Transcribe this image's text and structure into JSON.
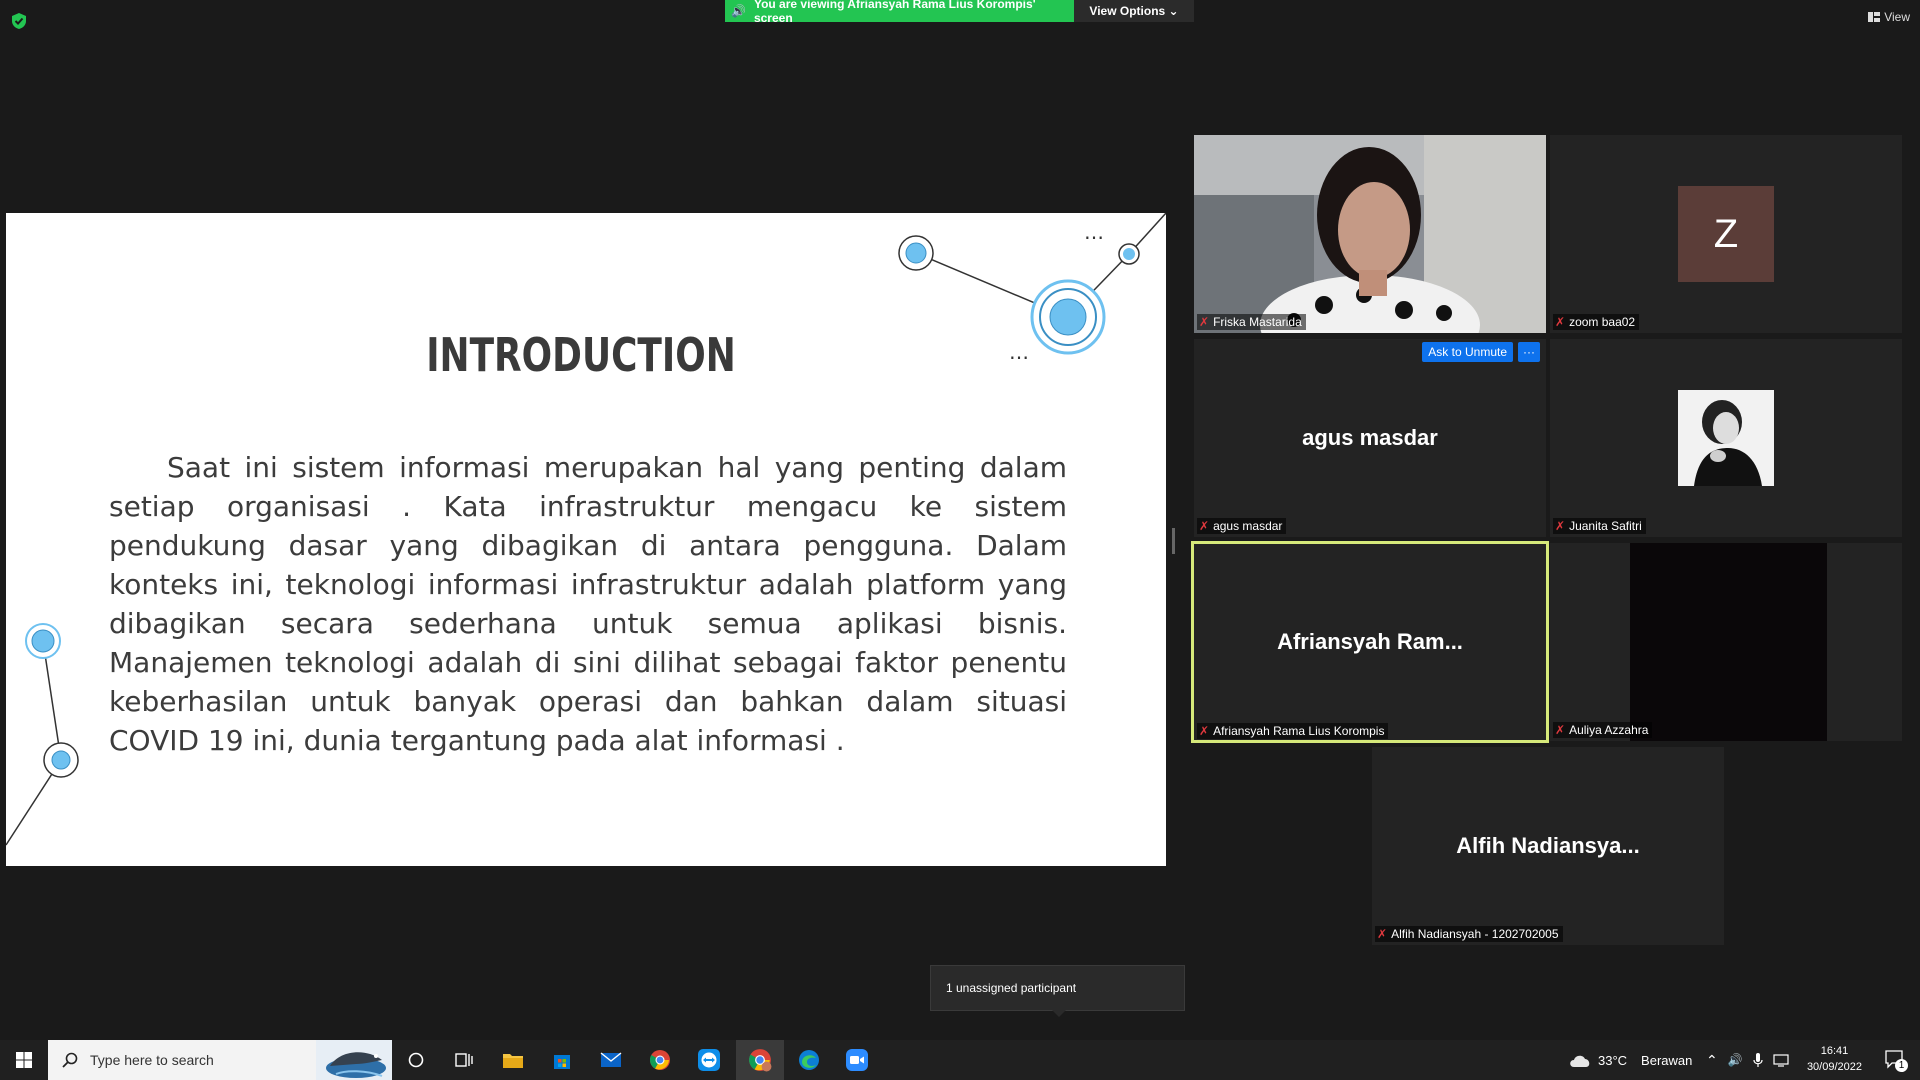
{
  "banner": {
    "viewing_text": "You are viewing Afriansyah Rama Lius Korompis' screen",
    "view_options_label": "View Options ⌄",
    "view_label": "View"
  },
  "slide": {
    "title": "INTRODUCTION",
    "body": "Saat ini sistem informasi merupakan hal yang penting dalam setiap organisasi . Kata infrastruktur mengacu ke sistem pendukung dasar yang dibagikan di antara pengguna. Dalam konteks ini, teknologi informasi infrastruktur adalah platform yang dibagikan secara sederhana untuk semua aplikasi bisnis. Manajemen teknologi adalah di sini dilihat sebagai faktor penentu keberhasilan untuk banyak operasi dan bahkan dalam situasi COVID 19 ini, dunia tergantung pada alat informasi ."
  },
  "participants": [
    {
      "name": "Friska Mastarida",
      "type": "video"
    },
    {
      "name": "zoom baa02",
      "type": "avatar",
      "initial": "Z"
    },
    {
      "name": "agus masdar",
      "type": "name",
      "display": "agus masdar"
    },
    {
      "name": "Juanita Safitri",
      "type": "photo"
    },
    {
      "name": "Afriansyah Rama Lius Korompis",
      "type": "name",
      "display": "Afriansyah  Ram..."
    },
    {
      "name": "Auliya Azzahra",
      "type": "video-dark"
    },
    {
      "name": "Alfih Nadiansyah - 1202702005",
      "type": "name",
      "display": "Alfih  Nadiansya..."
    }
  ],
  "tile_actions": {
    "ask_to_unmute": "Ask to Unmute",
    "more": "···"
  },
  "unassigned": "1 unassigned participant",
  "taskbar": {
    "search_placeholder": "Type here to search",
    "weather_temp": "33°C",
    "weather_desc": "Berawan",
    "time": "16:41",
    "date": "30/09/2022",
    "notification_count": "1"
  },
  "colors": {
    "banner_green": "#23c552",
    "slide_accent": "#6ec1f0",
    "active_speaker_border": "#d6e97a",
    "zoom_blue": "#0e72ed",
    "avatar_z": "#5b3d38"
  }
}
